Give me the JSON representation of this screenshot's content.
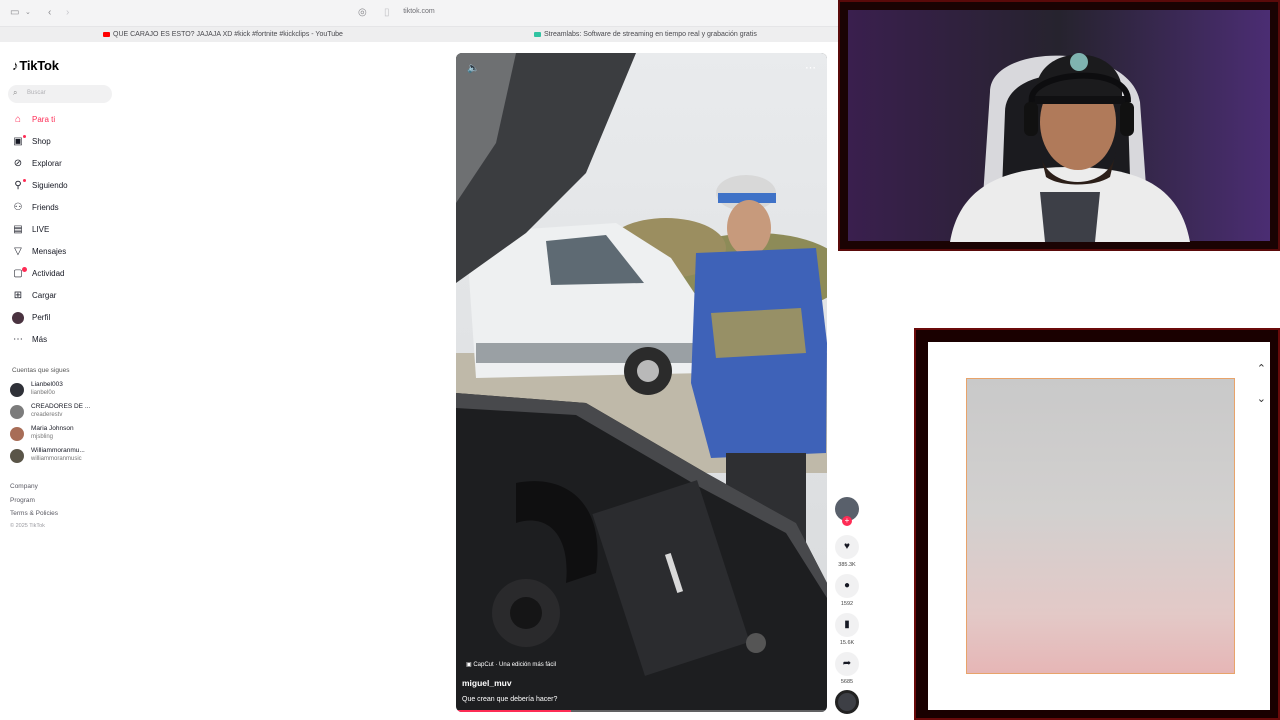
{
  "browser": {
    "url": "tiktok.com",
    "bookmarks": [
      {
        "label": "QUE CARAJO ES ESTO? JAJAJA XD #kick #fortnite #kickclips - YouTube",
        "color": "#ff0000"
      },
      {
        "label": "Streamlabs: Software de streaming en tiempo real y grabación gratis",
        "color": "#31c3a2"
      }
    ]
  },
  "sidebar": {
    "logo": "TikTok",
    "search_placeholder": "Buscar",
    "nav": [
      {
        "label": "Para ti",
        "icon": "home-icon"
      },
      {
        "label": "Shop",
        "icon": "shop-icon"
      },
      {
        "label": "Explorar",
        "icon": "compass-icon"
      },
      {
        "label": "Siguiendo",
        "icon": "following-icon"
      },
      {
        "label": "Friends",
        "icon": "friends-icon"
      },
      {
        "label": "LIVE",
        "icon": "live-icon"
      },
      {
        "label": "Mensajes",
        "icon": "messages-icon"
      },
      {
        "label": "Actividad",
        "icon": "activity-icon"
      },
      {
        "label": "Cargar",
        "icon": "upload-icon"
      },
      {
        "label": "Perfil",
        "icon": "profile-icon"
      },
      {
        "label": "Más",
        "icon": "more-icon"
      }
    ],
    "following_title": "Cuentas que sigues",
    "following": [
      {
        "name": "Lianbel003",
        "handle": "lianbel0o"
      },
      {
        "name": "CREADORES DE ...",
        "handle": "creaderestv"
      },
      {
        "name": "Maria Johnson",
        "handle": "mjsbling"
      },
      {
        "name": "Williammoranmu...",
        "handle": "williammoranmusic"
      }
    ],
    "footer_links": [
      "Company",
      "Program",
      "Terms & Policies"
    ],
    "copyright": "© 2025 TikTok"
  },
  "video": {
    "capcut_label": "CapCut · Una edición más fácil",
    "author": "miguel_muv",
    "caption": "Que crean que debería hacer?",
    "progress": 0.31
  },
  "actions": {
    "likes": "385.3K",
    "comments": "1592",
    "saves": "15.6K",
    "shares": "5685"
  },
  "widget": {
    "up_icon": "chevron-up-icon",
    "down_icon": "chevron-down-icon"
  }
}
